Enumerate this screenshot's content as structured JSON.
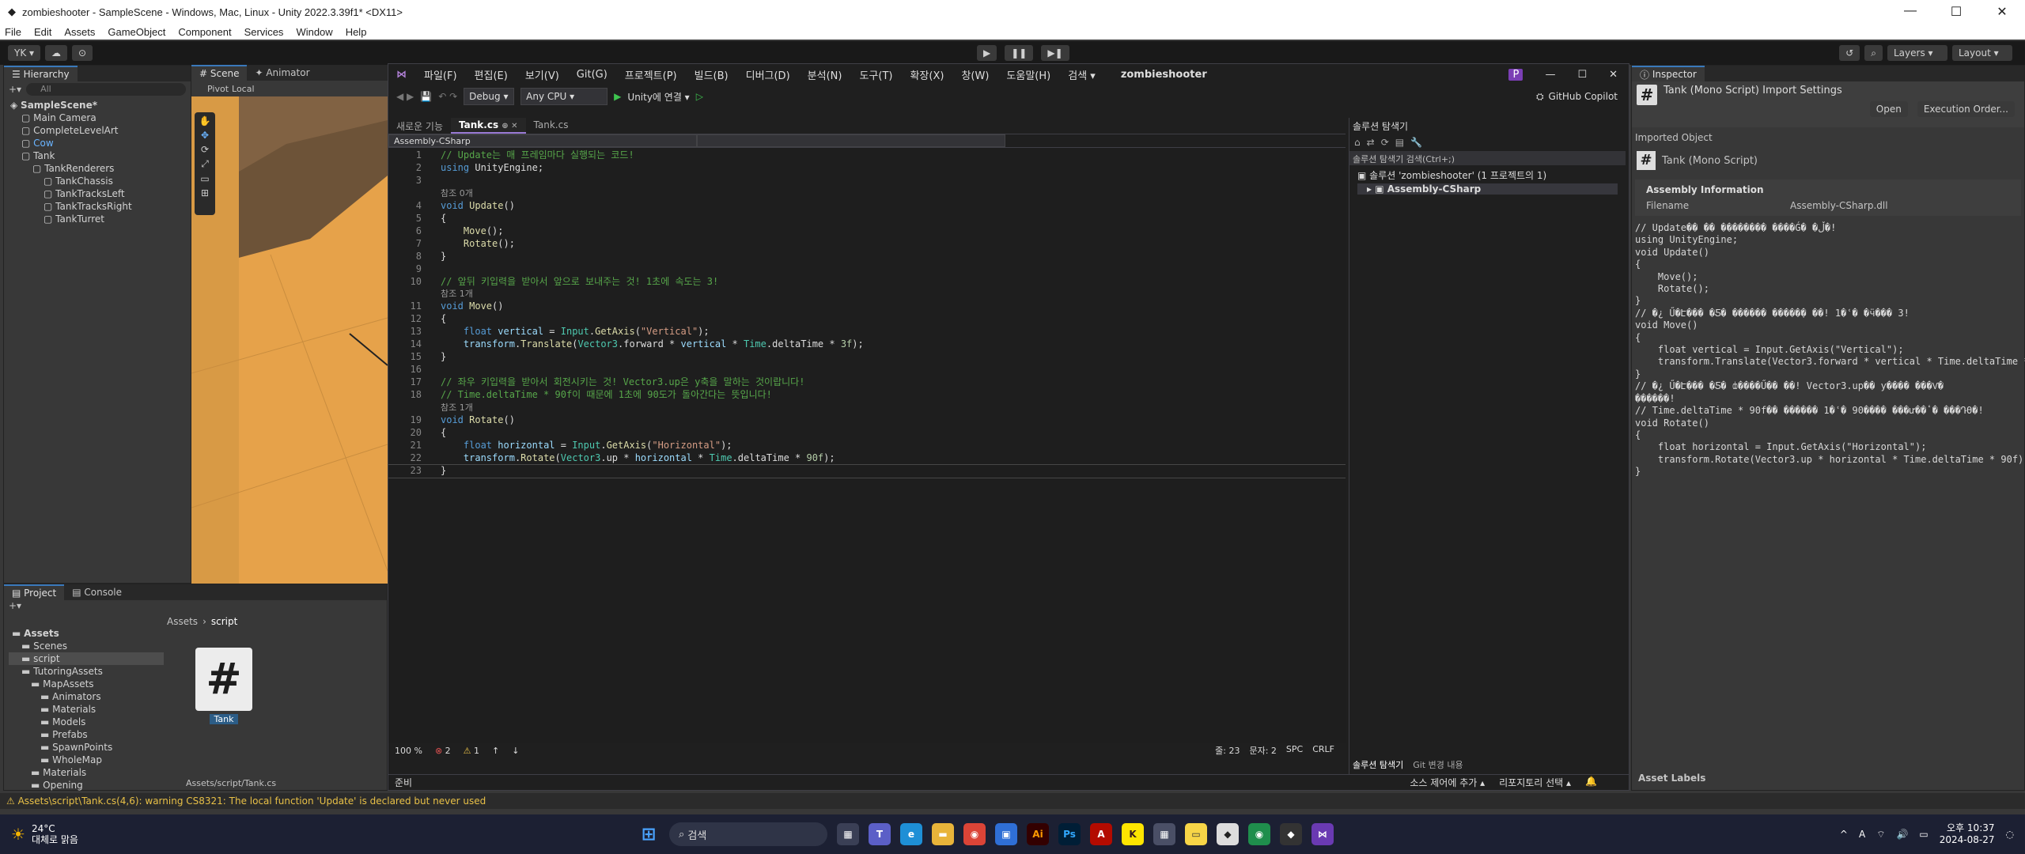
{
  "unity": {
    "title": "zombieshooter - SampleScene - Windows, Mac, Linux - Unity 2022.3.39f1* <DX11>",
    "menu": [
      "File",
      "Edit",
      "Assets",
      "GameObject",
      "Component",
      "Services",
      "Window",
      "Help"
    ],
    "account": "YK ▾",
    "layers": "Layers",
    "layout": "Layout",
    "hierarchy": {
      "tab": "Hierarchy",
      "search": "All",
      "items": [
        {
          "label": "SampleScene*",
          "indent": 0
        },
        {
          "label": "Main Camera",
          "indent": 1
        },
        {
          "label": "CompleteLevelArt",
          "indent": 1
        },
        {
          "label": "Cow",
          "indent": 1
        },
        {
          "label": "Tank",
          "indent": 1
        },
        {
          "label": "TankRenderers",
          "indent": 2
        },
        {
          "label": "TankChassis",
          "indent": 3
        },
        {
          "label": "TankTracksLeft",
          "indent": 3
        },
        {
          "label": "TankTracksRight",
          "indent": 3
        },
        {
          "label": "TankTurret",
          "indent": 3
        }
      ]
    },
    "scene": {
      "tabs": [
        "Scene",
        "Animator"
      ],
      "pivot": "Pivot",
      "local": "Local"
    },
    "project": {
      "tabs": [
        "Project",
        "Console"
      ],
      "breadcrumb": [
        "Assets",
        "script"
      ],
      "folders": [
        {
          "label": "Assets",
          "indent": 0
        },
        {
          "label": "Scenes",
          "indent": 1
        },
        {
          "label": "script",
          "indent": 1
        },
        {
          "label": "TutoringAssets",
          "indent": 1
        },
        {
          "label": "MapAssets",
          "indent": 2
        },
        {
          "label": "Animators",
          "indent": 3
        },
        {
          "label": "Materials",
          "indent": 3
        },
        {
          "label": "Models",
          "indent": 3
        },
        {
          "label": "Prefabs",
          "indent": 3
        },
        {
          "label": "SpawnPoints",
          "indent": 3
        },
        {
          "label": "WholeMap",
          "indent": 3
        },
        {
          "label": "Materials",
          "indent": 2
        },
        {
          "label": "Opening",
          "indent": 2
        }
      ],
      "asset_name": "Tank",
      "asset_path": "Assets/script/Tank.cs"
    },
    "inspector": {
      "tab": "Inspector",
      "title": "Tank (Mono Script) Import Settings",
      "open": "Open",
      "exec_order": "Execution Order...",
      "imported_object": "Imported Object",
      "script_name": "Tank (Mono Script)",
      "assembly_info": "Assembly Information",
      "filename_label": "Filename",
      "filename_value": "Assembly-CSharp.dll",
      "asset_labels": "Asset Labels",
      "preview": [
        "// Update�� �� �������� ����Ǵ� �ڵ�!",
        "using UnityEngine;",
        "",
        "void Update()",
        "{",
        "    Move();",
        "    Rotate();",
        "}",
        "",
        "// �¿ Ű�Է��� �޾Ƽ� ������ �����ִ� ��! 1�ʿ� �ӵ��� 3!",
        "void Move()",
        "{",
        "    float vertical = Input.GetAxis(\"Vertical\");",
        "    transform.Translate(Vector3.forward * vertical * Time.deltaTime * 3f);",
        "}",
        "",
        "// �¿ Ű�Է��� �޾Ƽ� ȸ����Ű�� ��! Vector3.up�� y���� ���Ѵ�",
        "������!",
        "// Time.deltaTime * 90f�� ������ 1�ʿ� 90���� ���ư��ٴ� ���Դϴ�!",
        "void Rotate()",
        "{",
        "    float horizontal = Input.GetAxis(\"Horizontal\");",
        "    transform.Rotate(Vector3.up * horizontal * Time.deltaTime * 90f);",
        "}"
      ]
    },
    "status_warning": "Assets\\script\\Tank.cs(4,6): warning CS8321: The local function 'Update' is declared but never used"
  },
  "vs": {
    "menu": [
      "파일(F)",
      "편집(E)",
      "보기(V)",
      "Git(G)",
      "프로젝트(P)",
      "빌드(B)",
      "디버그(D)",
      "분석(N)",
      "도구(T)",
      "확장(X)",
      "창(W)",
      "도움말(H)"
    ],
    "search": "검색 ▾",
    "solution_title": "zombieshooter",
    "config": "Debug",
    "platform": "Any CPU",
    "run": "Unity에 연결 ▾",
    "copilot": "GitHub Copilot",
    "tabs": [
      "새로운 기능",
      "Tank.cs",
      "Tank.cs"
    ],
    "nav_left": "Assembly-CSharp",
    "code": [
      {
        "n": "1",
        "t": [
          [
            "cm",
            "// Update는 매 프레임마다 실행되는 코드!"
          ]
        ]
      },
      {
        "n": "2",
        "t": [
          [
            "kw",
            "using "
          ],
          [
            "",
            "UnityEngine;"
          ]
        ]
      },
      {
        "n": "3",
        "t": []
      },
      {
        "n": "",
        "ref": "참조 0개"
      },
      {
        "n": "4",
        "t": [
          [
            "kw",
            "void "
          ],
          [
            "fn",
            "Update"
          ],
          [
            "",
            "()"
          ]
        ]
      },
      {
        "n": "5",
        "t": [
          [
            "",
            "{"
          ]
        ]
      },
      {
        "n": "6",
        "t": [
          [
            "",
            "    "
          ],
          [
            "fn",
            "Move"
          ],
          [
            "",
            "();"
          ]
        ]
      },
      {
        "n": "7",
        "t": [
          [
            "",
            "    "
          ],
          [
            "fn",
            "Rotate"
          ],
          [
            "",
            "();"
          ]
        ]
      },
      {
        "n": "8",
        "t": [
          [
            "",
            "}"
          ]
        ]
      },
      {
        "n": "9",
        "t": []
      },
      {
        "n": "10",
        "t": [
          [
            "cm",
            "// 앞뒤 키입력을 받아서 앞으로 보내주는 것! 1초에 속도는 3!"
          ]
        ]
      },
      {
        "n": "",
        "ref": "참조 1개"
      },
      {
        "n": "11",
        "t": [
          [
            "kw",
            "void "
          ],
          [
            "fn",
            "Move"
          ],
          [
            "",
            "()"
          ]
        ]
      },
      {
        "n": "12",
        "t": [
          [
            "",
            "{"
          ]
        ]
      },
      {
        "n": "13",
        "t": [
          [
            "",
            "    "
          ],
          [
            "kw",
            "float "
          ],
          [
            "vr",
            "vertical"
          ],
          [
            "",
            " = "
          ],
          [
            "ty",
            "Input"
          ],
          [
            "",
            "."
          ],
          [
            "fn",
            "GetAxis"
          ],
          [
            "",
            "("
          ],
          [
            "str",
            "\"Vertical\""
          ],
          [
            "",
            ");"
          ]
        ]
      },
      {
        "n": "14",
        "t": [
          [
            "",
            "    "
          ],
          [
            "vr",
            "transform"
          ],
          [
            "",
            "."
          ],
          [
            "fn",
            "Translate"
          ],
          [
            "",
            "("
          ],
          [
            "ty",
            "Vector3"
          ],
          [
            "",
            ".forward * "
          ],
          [
            "vr",
            "vertical"
          ],
          [
            "",
            " * "
          ],
          [
            "ty",
            "Time"
          ],
          [
            "",
            ".deltaTime * "
          ],
          [
            "nm",
            "3f"
          ],
          [
            "",
            ");"
          ]
        ]
      },
      {
        "n": "15",
        "t": [
          [
            "",
            "}"
          ]
        ]
      },
      {
        "n": "16",
        "t": []
      },
      {
        "n": "17",
        "t": [
          [
            "cm",
            "// 좌우 키입력을 받아서 회전시키는 것! Vector3.up은 y축을 말하는 것이랍니다!"
          ]
        ]
      },
      {
        "n": "18",
        "t": [
          [
            "cm",
            "// Time.deltaTime * 90f이 때문에 1초에 90도가 돌아간다는 뜻입니다!"
          ]
        ]
      },
      {
        "n": "",
        "ref": "참조 1개"
      },
      {
        "n": "19",
        "t": [
          [
            "kw",
            "void "
          ],
          [
            "fn",
            "Rotate"
          ],
          [
            "",
            "()"
          ]
        ]
      },
      {
        "n": "20",
        "t": [
          [
            "",
            "{"
          ]
        ]
      },
      {
        "n": "21",
        "t": [
          [
            "",
            "    "
          ],
          [
            "kw",
            "float "
          ],
          [
            "vr",
            "horizontal"
          ],
          [
            "",
            " = "
          ],
          [
            "ty",
            "Input"
          ],
          [
            "",
            "."
          ],
          [
            "fn",
            "GetAxis"
          ],
          [
            "",
            "("
          ],
          [
            "str",
            "\"Horizontal\""
          ],
          [
            "",
            ");"
          ]
        ]
      },
      {
        "n": "22",
        "t": [
          [
            "",
            "    "
          ],
          [
            "vr",
            "transform"
          ],
          [
            "",
            "."
          ],
          [
            "fn",
            "Rotate"
          ],
          [
            "",
            "("
          ],
          [
            "ty",
            "Vector3"
          ],
          [
            "",
            ".up * "
          ],
          [
            "vr",
            "horizontal"
          ],
          [
            "",
            " * "
          ],
          [
            "ty",
            "Time"
          ],
          [
            "",
            ".deltaTime * "
          ],
          [
            "nm",
            "90f"
          ],
          [
            "",
            ");"
          ]
        ]
      },
      {
        "n": "23",
        "t": [
          [
            "",
            "}"
          ]
        ]
      }
    ],
    "zoom": "100 %",
    "errors": "2",
    "warnings": "1",
    "pos_line": "줄: 23",
    "pos_char": "문자: 2",
    "spc": "SPC",
    "crlf": "CRLF",
    "ready": "준비",
    "source_control": "소스 제어에 추가 ▴",
    "repo": "리포지토리 선택 ▴",
    "se_title": "솔루션 탐색기",
    "se_search": "솔루션 탐색기 검색(Ctrl+;)",
    "se_solution": "솔루션 'zombieshooter' (1 프로젝트의 1)",
    "se_project": "Assembly-CSharp",
    "se_tabs": [
      "솔루션 탐색기",
      "Git 변경 내용"
    ]
  },
  "taskbar": {
    "temp": "24°C",
    "weather": "대체로 맑음",
    "search": "검색",
    "time": "오후 10:37",
    "date": "2024-08-27",
    "lang": "A"
  }
}
